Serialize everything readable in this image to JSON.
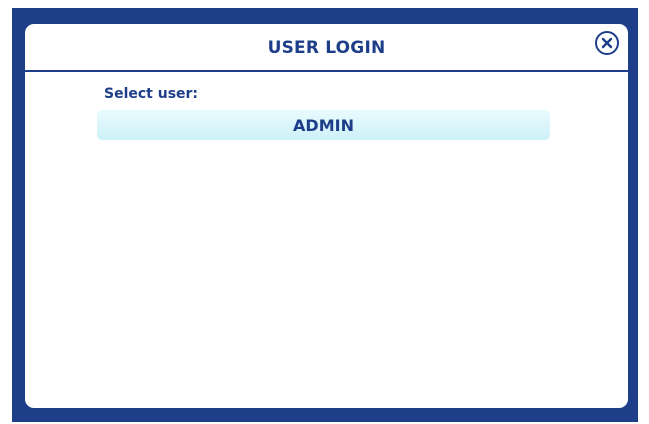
{
  "dialog": {
    "title": "USER LOGIN",
    "close_icon": "close-circle-icon"
  },
  "login": {
    "select_label": "Select user:",
    "users": [
      {
        "name": "ADMIN"
      }
    ]
  },
  "colors": {
    "frame": "#1f3e8a",
    "text": "#1f3e8a",
    "option_bg_top": "#e9fbfe",
    "option_bg_bottom": "#cdf1f8"
  }
}
